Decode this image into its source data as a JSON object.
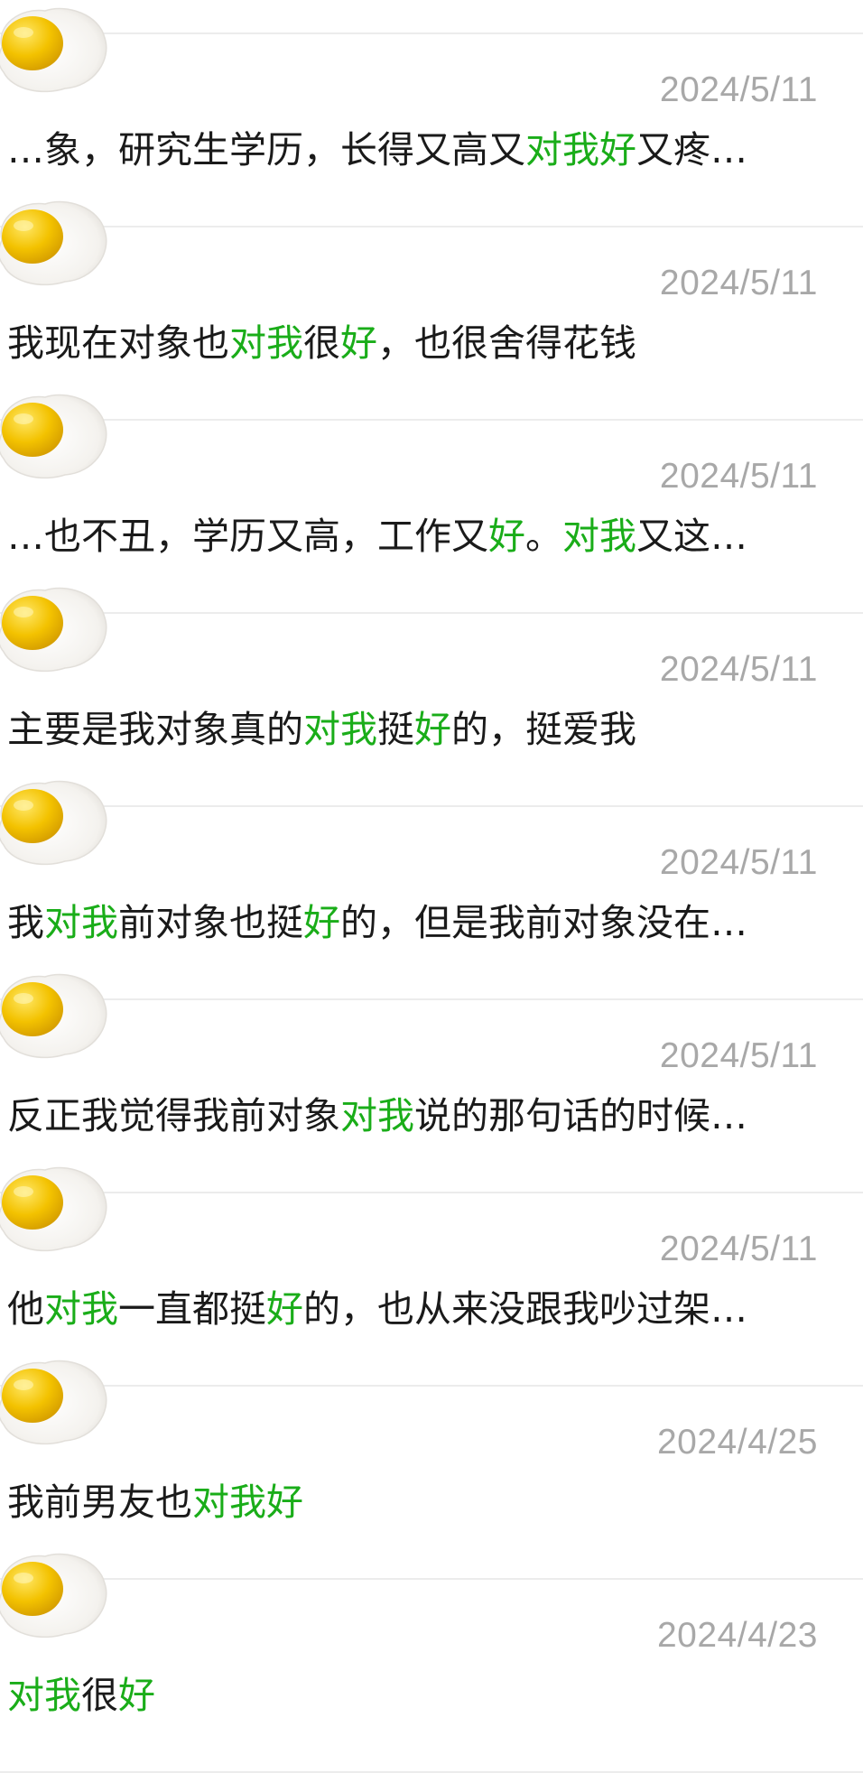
{
  "colors": {
    "highlight": "#1aad19",
    "text": "#1a1a1a",
    "date": "#a8a8a8",
    "divider": "#ececec"
  },
  "avatar_icon": "fried-egg-icon",
  "results": [
    {
      "date": "2024/5/11",
      "segments": [
        {
          "text": "…象，研究生学历，长得又高又",
          "hl": false
        },
        {
          "text": "对我好",
          "hl": true
        },
        {
          "text": "又疼…",
          "hl": false
        }
      ]
    },
    {
      "date": "2024/5/11",
      "segments": [
        {
          "text": "我现在对象也",
          "hl": false
        },
        {
          "text": "对我",
          "hl": true
        },
        {
          "text": "很",
          "hl": false
        },
        {
          "text": "好",
          "hl": true
        },
        {
          "text": "，也很舍得花钱",
          "hl": false
        }
      ]
    },
    {
      "date": "2024/5/11",
      "segments": [
        {
          "text": "…也不丑，学历又高，工作又",
          "hl": false
        },
        {
          "text": "好",
          "hl": true
        },
        {
          "text": "。",
          "hl": false
        },
        {
          "text": "对我",
          "hl": true
        },
        {
          "text": "又这…",
          "hl": false
        }
      ]
    },
    {
      "date": "2024/5/11",
      "segments": [
        {
          "text": "主要是我对象真的",
          "hl": false
        },
        {
          "text": "对我",
          "hl": true
        },
        {
          "text": "挺",
          "hl": false
        },
        {
          "text": "好",
          "hl": true
        },
        {
          "text": "的，挺爱我",
          "hl": false
        }
      ]
    },
    {
      "date": "2024/5/11",
      "segments": [
        {
          "text": "我",
          "hl": false
        },
        {
          "text": "对我",
          "hl": true
        },
        {
          "text": "前对象也挺",
          "hl": false
        },
        {
          "text": "好",
          "hl": true
        },
        {
          "text": "的，但是我前对象没在…",
          "hl": false
        }
      ]
    },
    {
      "date": "2024/5/11",
      "segments": [
        {
          "text": "反正我觉得我前对象",
          "hl": false
        },
        {
          "text": "对我",
          "hl": true
        },
        {
          "text": "说的那句话的时候…",
          "hl": false
        }
      ]
    },
    {
      "date": "2024/5/11",
      "segments": [
        {
          "text": "他",
          "hl": false
        },
        {
          "text": "对我",
          "hl": true
        },
        {
          "text": "一直都挺",
          "hl": false
        },
        {
          "text": "好",
          "hl": true
        },
        {
          "text": "的，也从来没跟我吵过架…",
          "hl": false
        }
      ]
    },
    {
      "date": "2024/4/25",
      "segments": [
        {
          "text": "我前男友也",
          "hl": false
        },
        {
          "text": "对我好",
          "hl": true
        }
      ]
    },
    {
      "date": "2024/4/23",
      "segments": [
        {
          "text": "对我",
          "hl": true
        },
        {
          "text": "很",
          "hl": false
        },
        {
          "text": "好",
          "hl": true
        }
      ]
    }
  ]
}
